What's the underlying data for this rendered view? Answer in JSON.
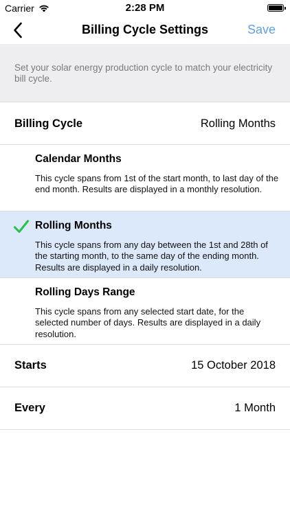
{
  "status": {
    "carrier": "Carrier",
    "time": "2:28 PM"
  },
  "nav": {
    "title": "Billing Cycle Settings",
    "save_label": "Save",
    "back_icon": "chevron-left-icon"
  },
  "description": "Set your solar energy production cycle to match your electricity bill cycle.",
  "billing_cycle": {
    "label": "Billing Cycle",
    "value": "Rolling Months"
  },
  "options": [
    {
      "title": "Calendar Months",
      "body": "This cycle spans from 1st of the start month, to last day of the end month. Results are displayed in a monthly resolution.",
      "selected": false
    },
    {
      "title": "Rolling Months",
      "body": "This cycle spans from any day between the 1st and 28th of the starting month, to the same day of the ending month. Results are displayed in a daily resolution.",
      "selected": true
    },
    {
      "title": "Rolling Days Range",
      "body": "This cycle spans from any selected start date, for the selected number of days. Results are displayed in a daily resolution.",
      "selected": false
    }
  ],
  "starts": {
    "label": "Starts",
    "value": "15 October 2018"
  },
  "every": {
    "label": "Every",
    "value": "1 Month"
  },
  "colors": {
    "accent": "#5d9fe6",
    "selected_bg": "#dce9fa",
    "check": "#2fbf4f"
  }
}
